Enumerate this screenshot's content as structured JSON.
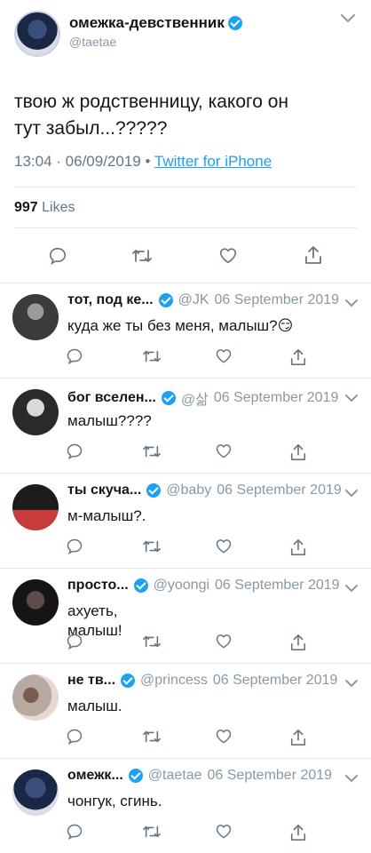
{
  "main_tweet": {
    "display_name": "омежка-девственник",
    "handle": "@taetae",
    "text_line1": "твою ж родственницу, какого он",
    "text_line2": "тут забыл...?????",
    "time": "13:04",
    "date": "06/09/2019",
    "source": "Twitter for iPhone",
    "likes_count": "997",
    "likes_label": "Likes"
  },
  "replies": [
    {
      "name": "тот, под ке...",
      "handle": "@JK",
      "date": "06 September 2019",
      "text": "куда же ты без меня, малыш?",
      "emoji": "😏",
      "avatar_colors": [
        "#3b3b3b",
        "#9a9a9a"
      ]
    },
    {
      "name": "бог вселен...",
      "handle": "@삶",
      "date": "06 September 2019",
      "text": "малыш????",
      "avatar_colors": [
        "#2a2a2a",
        "#d9d9d9"
      ]
    },
    {
      "name": "ты скуча...",
      "handle": "@baby",
      "date": "06 September 2019",
      "text": "м-малыш?.",
      "avatar_colors": [
        "#1c1c1c",
        "#c73b3b"
      ]
    },
    {
      "name": "просто...",
      "handle": "@yoongi",
      "date": "06 September 2019",
      "text_line1": "ахуеть,",
      "text_line2": "малыш!",
      "avatar_colors": [
        "#151515",
        "#5e4a4a"
      ]
    },
    {
      "name": "не тв...",
      "handle": "@princess",
      "date": "06 September 2019",
      "text": "малыш.",
      "avatar_colors": [
        "#b8a9a3",
        "#7b5d4f"
      ]
    },
    {
      "name": "омежк...",
      "handle": "@taetae",
      "date": "06 September 2019",
      "text": "чонгук, сгинь.",
      "avatar_colors": [
        "#1b2845",
        "#d8dde6"
      ]
    }
  ],
  "icons": [
    "reply-icon",
    "retweet-icon",
    "like-icon",
    "share-icon",
    "verified-badge-icon",
    "chevron-down-icon"
  ],
  "colors": {
    "link": "#1da1f2",
    "muted": "#8899a6",
    "text": "#14171a",
    "divider": "#e1e8ed",
    "icon": "#657786"
  }
}
